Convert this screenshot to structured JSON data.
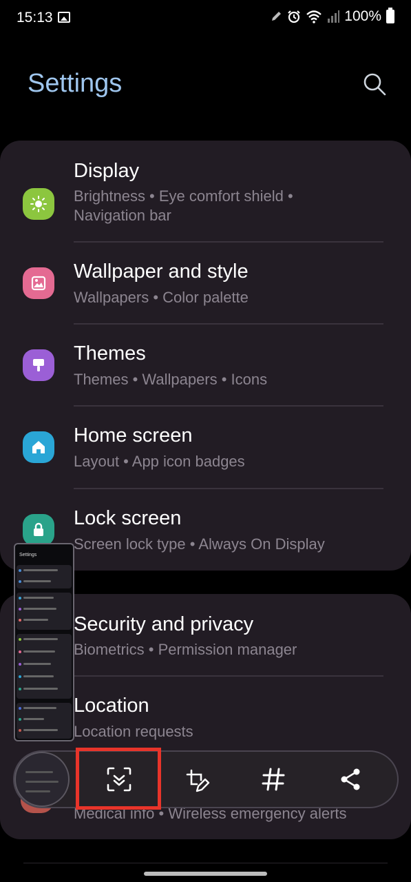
{
  "status": {
    "time": "15:13",
    "battery": "100%"
  },
  "header": {
    "title": "Settings"
  },
  "settings_group1": [
    {
      "title": "Display",
      "subtitle_line1": "Brightness  •  Eye comfort shield  •",
      "subtitle_line2": "Navigation bar",
      "icon": "display-icon",
      "color": "#8cc63f"
    },
    {
      "title": "Wallpaper and style",
      "subtitle_line1": "Wallpapers  •  Color palette",
      "icon": "wallpaper-icon",
      "color": "#e46a92"
    },
    {
      "title": "Themes",
      "subtitle_line1": "Themes  •  Wallpapers  •  Icons",
      "icon": "themes-icon",
      "color": "#9b5fd6"
    },
    {
      "title": "Home screen",
      "subtitle_line1": "Layout  •  App icon badges",
      "icon": "home-icon",
      "color": "#2aa6d6"
    },
    {
      "title": "Lock screen",
      "subtitle_line1": "Screen lock type  •  Always On Display",
      "icon": "lock-icon",
      "color": "#2aa38a"
    }
  ],
  "settings_group2": [
    {
      "title": "Security and privacy",
      "subtitle_line1": "Biometrics  •  Permission manager"
    },
    {
      "title": "Location",
      "subtitle_line1": "Location requests"
    }
  ],
  "partial_row": {
    "subtitle": "Medical info  •  Wireless emergency alerts"
  },
  "thumbnail": {
    "title": "Settings"
  },
  "toolbar": {
    "buttons": [
      "scroll-capture-icon",
      "crop-edit-icon",
      "hashtag-icon",
      "share-icon"
    ]
  },
  "colors": {
    "accent_title": "#9fc6ee",
    "card_bg": "#221c24",
    "highlight": "#e8342a"
  }
}
